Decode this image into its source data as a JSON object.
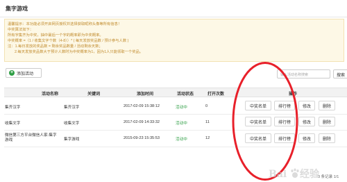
{
  "page": {
    "title": "集字游戏"
  },
  "notice": {
    "lines": [
      "温馨提示：本功能必须开启网页授权并选择获取昵称头像等所有信息！",
      "中奖算法如下：",
      "所有字集齐为中奖，抽中最后一个字的概率即为中奖概率。",
      "中奖概率 =（1 / 收集文字个数（4-8））* ( 每天发放奖品数 / 预计参与人数 )",
      "注：1.每日发放的奖品数 = 剩余奖品数量 / 活动剩余天数；",
      "2.每天发放奖品数大于预计人数时为中奖概率为1，因为1人只能领取一个奖品。"
    ]
  },
  "toolbar": {
    "add_label": "添加活动",
    "search_placeholder": "输入活动名称搜索",
    "search_label": "搜索"
  },
  "table": {
    "headers": {
      "name": "活动名称",
      "keyword": "关键词",
      "time": "添加时间",
      "status": "活动状态",
      "opens": "打开次数",
      "ops": "操作"
    },
    "rows": [
      {
        "name": "集齐汉字",
        "keyword": "集齐汉字",
        "time": "2017-02-09 15:38:12",
        "status": "活动中",
        "opens": "0"
      },
      {
        "name": "收集文字",
        "keyword": "收集文字",
        "time": "2017-02-09 14:33:32",
        "status": "活动中",
        "opens": "11"
      },
      {
        "name": "微信第三方平台微信人家-集字游戏",
        "keyword": "集字游戏",
        "time": "2015-09-23 15:35:53",
        "status": "活动中",
        "opens": "12"
      }
    ],
    "actions": {
      "winners": "中奖名单",
      "ranking": "排行榜",
      "edit": "修改",
      "delete": "删除"
    }
  },
  "pager": {
    "text": "3 条记录 1/1"
  },
  "annotation": {
    "color": "#e8202a"
  },
  "colors": {
    "status_active": "#2e9e44",
    "notice_text": "#c08a2c",
    "notice_bg": "#fdf8e6"
  },
  "watermark": {
    "text": "Baidu经验"
  }
}
